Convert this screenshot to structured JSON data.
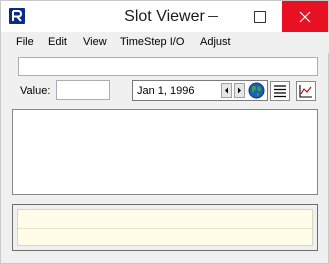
{
  "window": {
    "title": "Slot Viewer",
    "icon": "riverware-icon",
    "controls": [
      "minimize-icon",
      "maximize-icon",
      "close-icon"
    ],
    "close_color": "#e81123"
  },
  "menu": {
    "items": [
      {
        "label": "File"
      },
      {
        "label": "Edit"
      },
      {
        "label": "View"
      },
      {
        "label": "TimeStep I/O"
      },
      {
        "label": "Adjust"
      }
    ]
  },
  "slot_path": {
    "value": ""
  },
  "value_row": {
    "label": "Value:",
    "value": ""
  },
  "date": {
    "value": "Jan 1, 1996",
    "prev_icon": "arrow-left-icon",
    "next_icon": "arrow-right-icon",
    "globe_icon": "globe-icon"
  },
  "tools": {
    "list_icon": "list-icon",
    "plot_icon": "plot-icon"
  },
  "colors": {
    "bottom_panel": "#fffde8"
  }
}
